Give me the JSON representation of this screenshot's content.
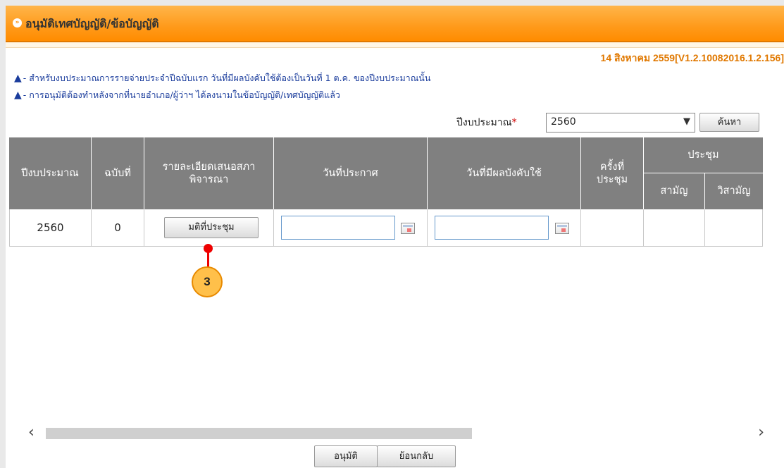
{
  "header": {
    "title": "อนุมัติเทศบัญญัติ/ข้อบัญญัติ",
    "bullet_icon": "chevron-circle-icon"
  },
  "version": "14 สิงหาคม 2559[V1.2.10082016.1.2.156]",
  "notes": [
    "- สำหรับงบประมาณการรายจ่ายประจำปีฉบับแรก วันที่มีผลบังคับใช้ต้องเป็นวันที่ 1 ต.ค. ของปีงบประมาณนั้น",
    "- การอนุมัติต้องทำหลังจากที่นายอำเภอ/ผู้ว่าฯ ได้ลงนามในข้อบัญญัติ/เทศบัญญัติแล้ว"
  ],
  "filter": {
    "year_label": "ปีงบประมาณ",
    "required_mark": "*",
    "year_value": "2560",
    "search_label": "ค้นหา"
  },
  "table": {
    "headers": {
      "fiscal_year": "ปีงบประมาณ",
      "edition": "ฉบับที่",
      "detail": "รายละเอียดเสนอสภาพิจารณา",
      "announce_date": "วันที่ประกาศ",
      "effective_date": "วันที่มีผลบังคับใช้",
      "session_no": "ครั้งที่ประชุม",
      "meeting": "ประชุม",
      "ordinary": "สามัญ",
      "extraordinary": "วิสามัญ"
    },
    "rows": [
      {
        "fiscal_year": "2560",
        "edition": "0",
        "detail_button": "มติที่ประชุม",
        "announce_date": "",
        "effective_date": "",
        "session_no": "",
        "ordinary": "",
        "extraordinary": ""
      }
    ]
  },
  "annotation": {
    "step": "3"
  },
  "scroll": {
    "left": "‹",
    "right": "›"
  },
  "footer": {
    "approve_label": "อนุมัติ",
    "back_label": "ย้อนกลับ"
  }
}
